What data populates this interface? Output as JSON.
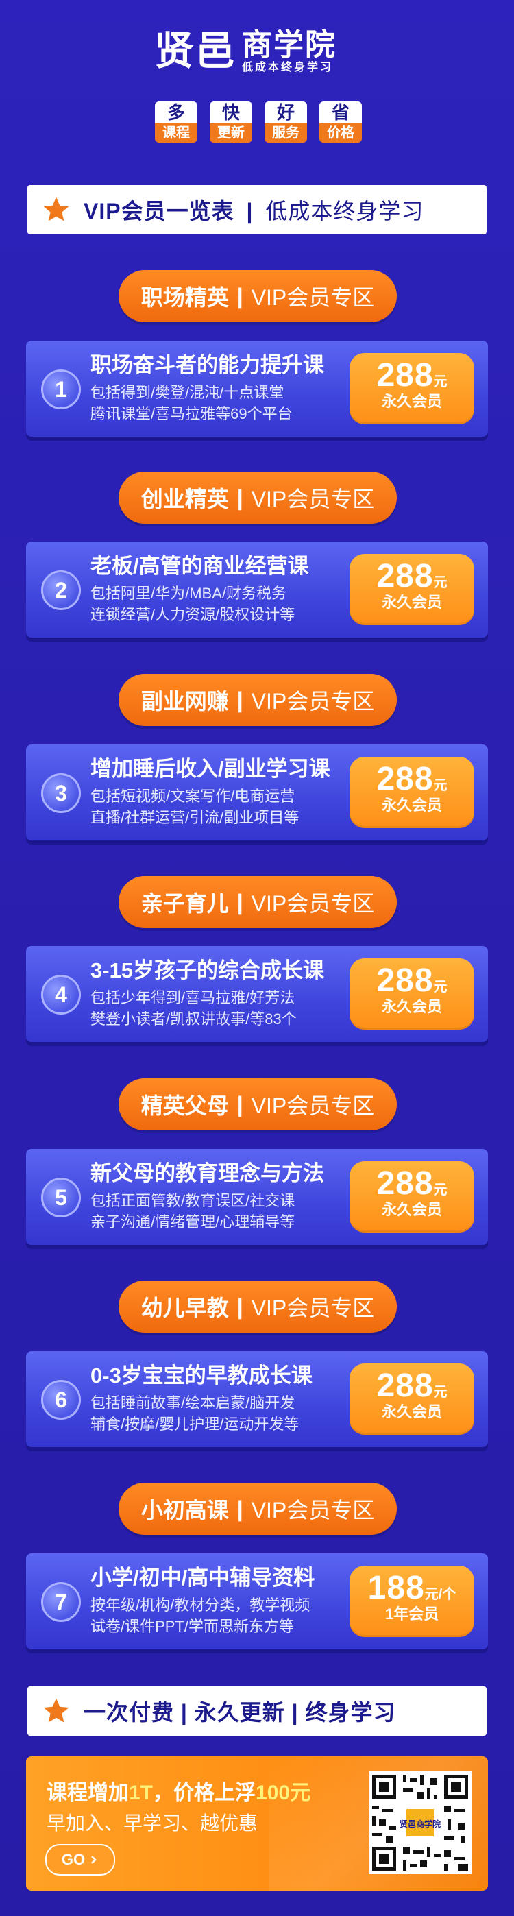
{
  "header": {
    "brand_mark": "贤邑",
    "brand_name": "商学院",
    "slogan": "低成本终身学习",
    "badges": [
      {
        "top": "多",
        "bottom": "课程"
      },
      {
        "top": "快",
        "bottom": "更新"
      },
      {
        "top": "好",
        "bottom": "服务"
      },
      {
        "top": "省",
        "bottom": "价格"
      }
    ]
  },
  "overview_bar": {
    "icon": "star-icon",
    "strong": "VIP会员一览表",
    "sep": "|",
    "light": "低成本终身学习"
  },
  "sections": [
    {
      "pill_strong": "职场精英",
      "pill_sep": "|",
      "pill_light": "VIP会员专区",
      "card": {
        "num": "1",
        "title": "职场奋斗者的能力提升课",
        "desc1": "包括得到/樊登/混沌/十点课堂",
        "desc2": "腾讯课堂/喜马拉雅等69个平台",
        "price": "288",
        "unit": "元",
        "sub": "永久会员"
      }
    },
    {
      "pill_strong": "创业精英",
      "pill_sep": "|",
      "pill_light": "VIP会员专区",
      "card": {
        "num": "2",
        "title": "老板/高管的商业经营课",
        "desc1": "包括阿里/华为/MBA/财务税务",
        "desc2": "连锁经营/人力资源/股权设计等",
        "price": "288",
        "unit": "元",
        "sub": "永久会员"
      }
    },
    {
      "pill_strong": "副业网赚",
      "pill_sep": "|",
      "pill_light": "VIP会员专区",
      "card": {
        "num": "3",
        "title": "增加睡后收入/副业学习课",
        "desc1": "包括短视频/文案写作/电商运营",
        "desc2": "直播/社群运营/引流/副业项目等",
        "price": "288",
        "unit": "元",
        "sub": "永久会员"
      }
    },
    {
      "pill_strong": "亲子育儿",
      "pill_sep": "|",
      "pill_light": "VIP会员专区",
      "card": {
        "num": "4",
        "title": "3-15岁孩子的综合成长课",
        "desc1": "包括少年得到/喜马拉雅/好芳法",
        "desc2": "樊登小读者/凯叔讲故事/等83个",
        "price": "288",
        "unit": "元",
        "sub": "永久会员"
      }
    },
    {
      "pill_strong": "精英父母",
      "pill_sep": "|",
      "pill_light": "VIP会员专区",
      "card": {
        "num": "5",
        "title": "新父母的教育理念与方法",
        "desc1": "包括正面管教/教育误区/社交课",
        "desc2": "亲子沟通/情绪管理/心理辅导等",
        "price": "288",
        "unit": "元",
        "sub": "永久会员"
      }
    },
    {
      "pill_strong": "幼儿早教",
      "pill_sep": "|",
      "pill_light": "VIP会员专区",
      "card": {
        "num": "6",
        "title": "0-3岁宝宝的早教成长课",
        "desc1": "包括睡前故事/绘本启蒙/脑开发",
        "desc2": "辅食/按摩/婴儿护理/运动开发等",
        "price": "288",
        "unit": "元",
        "sub": "永久会员"
      }
    },
    {
      "pill_strong": "小初高课",
      "pill_sep": "|",
      "pill_light": "VIP会员专区",
      "card": {
        "num": "7",
        "title": "小学/初中/高中辅导资料",
        "desc1": "按年级/机构/教材分类，教学视频",
        "desc2": "试卷/课件PPT/学而思新东方等",
        "price": "188",
        "unit": "元/个",
        "sub": "1年会员"
      }
    }
  ],
  "footer_bar": {
    "icon": "star-icon",
    "text": "一次付费 | 永久更新 | 终身学习"
  },
  "promo": {
    "line1_a": "课程增加",
    "line1_b": "1T",
    "line1_c": "，价格上浮",
    "line1_d": "100元",
    "line2": "早加入、早学习、越优惠",
    "go": "GO",
    "qr_label": "贤邑商学院"
  },
  "colors": {
    "background": "#2a1fb0",
    "orange": "#f07a1b",
    "price": "#ff9d26",
    "card": "#4a52e6",
    "text_dark": "#1c1a8c"
  }
}
